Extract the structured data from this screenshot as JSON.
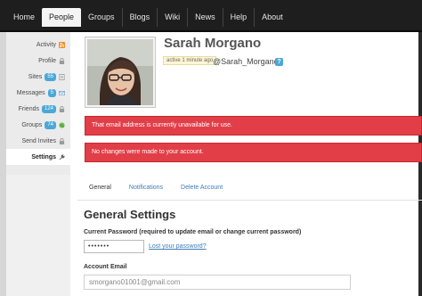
{
  "topnav": {
    "items": [
      {
        "label": "Home"
      },
      {
        "label": "People"
      },
      {
        "label": "Groups"
      },
      {
        "label": "Blogs"
      },
      {
        "label": "Wiki"
      },
      {
        "label": "News"
      },
      {
        "label": "Help"
      },
      {
        "label": "About"
      }
    ],
    "active": "People"
  },
  "sidebar": {
    "items": [
      {
        "label": "Activity",
        "badge": "",
        "icon": "rss-icon"
      },
      {
        "label": "Profile",
        "badge": "",
        "icon": "lock-icon"
      },
      {
        "label": "Sites",
        "badge": "55",
        "icon": "document-icon"
      },
      {
        "label": "Messages",
        "badge": "5",
        "icon": "envelope-icon"
      },
      {
        "label": "Friends",
        "badge": "124",
        "icon": "lock-icon"
      },
      {
        "label": "Groups",
        "badge": "74",
        "icon": "globe-icon"
      },
      {
        "label": "Send Invites",
        "badge": "",
        "icon": "lock-icon"
      },
      {
        "label": "Settings",
        "badge": "",
        "icon": "wrench-icon"
      }
    ],
    "active": "Settings"
  },
  "profile": {
    "name": "Sarah Morgano",
    "activity": "active 1 minute ago",
    "handle": "@Sarah_Morgano",
    "handle_badge": "?"
  },
  "alerts": [
    "That email address is currently unavailable for use.",
    "No changes were made to your account."
  ],
  "tabs": [
    {
      "label": "General"
    },
    {
      "label": "Notifications"
    },
    {
      "label": "Delete Account"
    }
  ],
  "settings": {
    "title": "General Settings",
    "current_password_label": "Current Password (required to update email or change current password)",
    "password_value": "•••••••",
    "lost_password_link": "Lost your password?",
    "email_label": "Account Email",
    "email_value": "smorgano01001@gmail.com"
  },
  "colors": {
    "nav_bg": "#1e1e1e",
    "alert_red": "#e13e48",
    "badge_blue": "#4aa8d8",
    "link_blue": "#3d7cb8"
  }
}
